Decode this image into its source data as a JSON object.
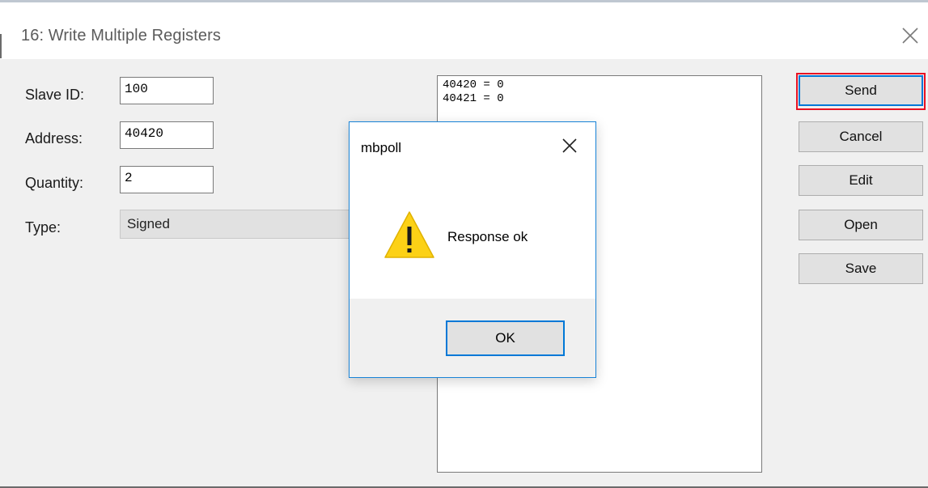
{
  "dialog": {
    "title": "16: Write Multiple Registers",
    "fields": {
      "slave_id": {
        "label": "Slave ID:",
        "value": "100"
      },
      "address": {
        "label": "Address:",
        "value": "40420"
      },
      "quantity": {
        "label": "Quantity:",
        "value": "2"
      },
      "type": {
        "label": "Type:",
        "value": "Signed"
      }
    },
    "registers": [
      "40420 = 0",
      "40421 = 0"
    ],
    "buttons": {
      "send": "Send",
      "cancel": "Cancel",
      "edit": "Edit",
      "open": "Open",
      "save": "Save"
    }
  },
  "message_box": {
    "title": "mbpoll",
    "icon": "warning-icon",
    "message": "Response ok",
    "ok_label": "OK"
  },
  "colors": {
    "accent": "#0078d7",
    "highlight": "#e81123",
    "warning": "#fcd116"
  }
}
